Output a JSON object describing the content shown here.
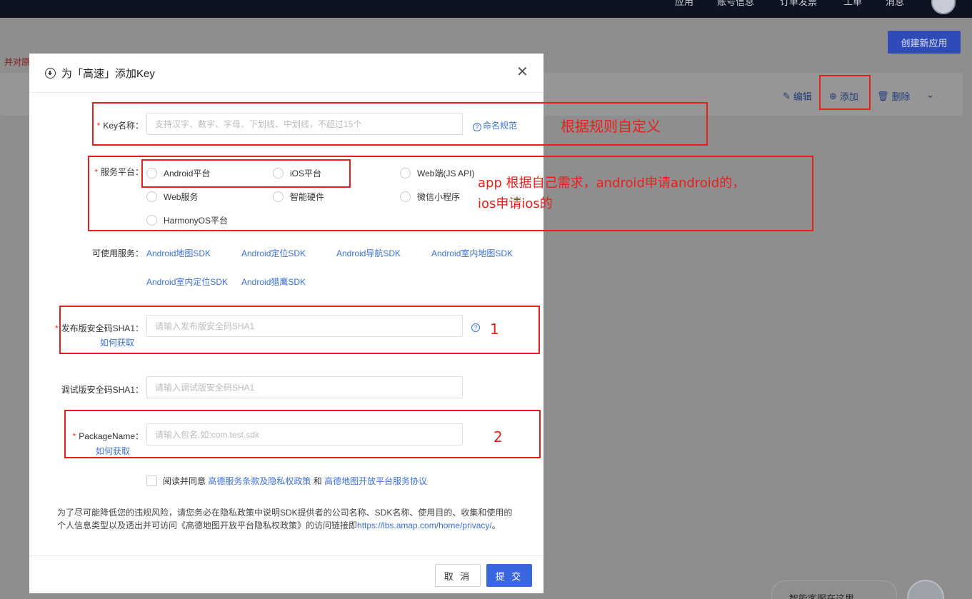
{
  "topnav": {
    "items": [
      "应用",
      "账号信息",
      "订单发票",
      "工单",
      "消息"
    ]
  },
  "background": {
    "create_app_button": "创建新应用",
    "warning_partial": "并对原",
    "card_actions": {
      "edit": "编辑",
      "add": "添加",
      "delete": "删除"
    },
    "chat_bubble": "智能客服在这里"
  },
  "modal": {
    "title": "为「高速」添加Key",
    "key_name": {
      "label": "Key名称：",
      "placeholder": "支持汉字、数字、字母、下划线、中划线，不超过15个",
      "help_link": "命名规范"
    },
    "platform": {
      "label": "服务平台：",
      "options": [
        "Android平台",
        "iOS平台",
        "Web端(JS API)",
        "Web服务",
        "智能硬件",
        "微信小程序",
        "HarmonyOS平台"
      ]
    },
    "services": {
      "label": "可使用服务：",
      "items": [
        "Android地图SDK",
        "Android定位SDK",
        "Android导航SDK",
        "Android室内地图SDK",
        "Android室内定位SDK",
        "Android猎鹰SDK"
      ]
    },
    "release_sha1": {
      "label": "发布版安全码SHA1：",
      "placeholder": "请输入发布版安全码SHA1",
      "how_link": "如何获取"
    },
    "debug_sha1": {
      "label": "调试版安全码SHA1：",
      "placeholder": "请输入调试版安全码SHA1"
    },
    "package_name": {
      "label": "PackageName：",
      "placeholder": "请输入包名,如:com.test.sdk",
      "how_link": "如何获取"
    },
    "agreement": {
      "prefix": "阅读并同意",
      "link1": "高德服务条款及隐私权政策",
      "and": "和",
      "link2": "高德地图开放平台服务协议"
    },
    "notice": {
      "line1": "为了尽可能降低您的违规风险，请您务必在隐私政策中说明SDK提供者的公司名称、SDK名称、使用目的、收集和使用的",
      "line2_text": "个人信息类型以及透出并可访问《高德地图开放平台隐私权政策》的访问链接即",
      "line2_link": "https://lbs.amap.com/home/privacy/",
      "line2_end": "。"
    },
    "buttons": {
      "cancel": "取 消",
      "submit": "提 交"
    }
  },
  "annotations": {
    "key_note": "根据规则自定义",
    "platform_note_line1": "app 根据自己需求，android申请android的，",
    "platform_note_line2": "ios申请ios的",
    "num1": "1",
    "num2": "2"
  },
  "colors": {
    "annotation": "#e8201c",
    "link": "#3b6fd8",
    "primary": "#3a66e0"
  }
}
